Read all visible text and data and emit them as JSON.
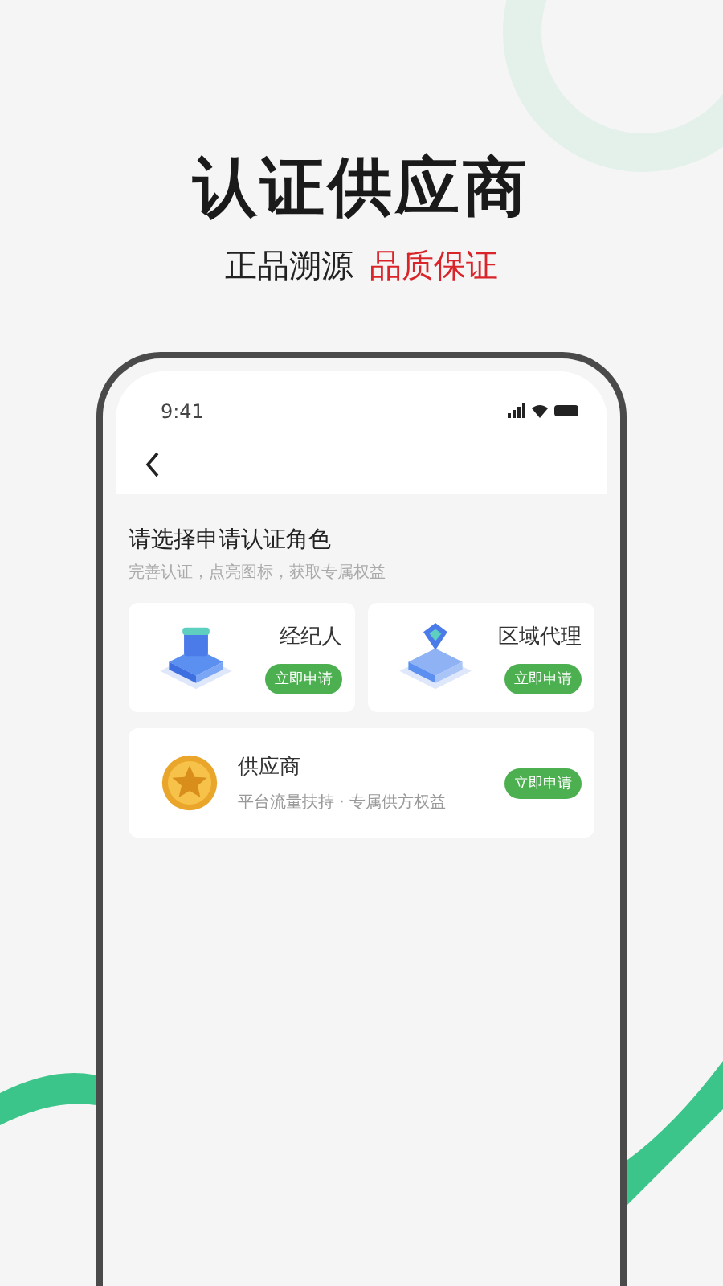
{
  "headline": "认证供应商",
  "tagline": {
    "text": "正品溯源",
    "highlight": "品质保证"
  },
  "phone": {
    "time": "9:41",
    "heading": "请选择申请认证角色",
    "subheading": "完善认证，点亮图标，获取专属权益",
    "roles": [
      {
        "kind": "tile",
        "name": "经纪人",
        "button": "立即申请"
      },
      {
        "kind": "tile",
        "name": "区域代理",
        "button": "立即申请"
      },
      {
        "kind": "wide",
        "name": "供应商",
        "desc": "平台流量扶持 · 专属供方权益",
        "button": "立即申请"
      }
    ]
  }
}
